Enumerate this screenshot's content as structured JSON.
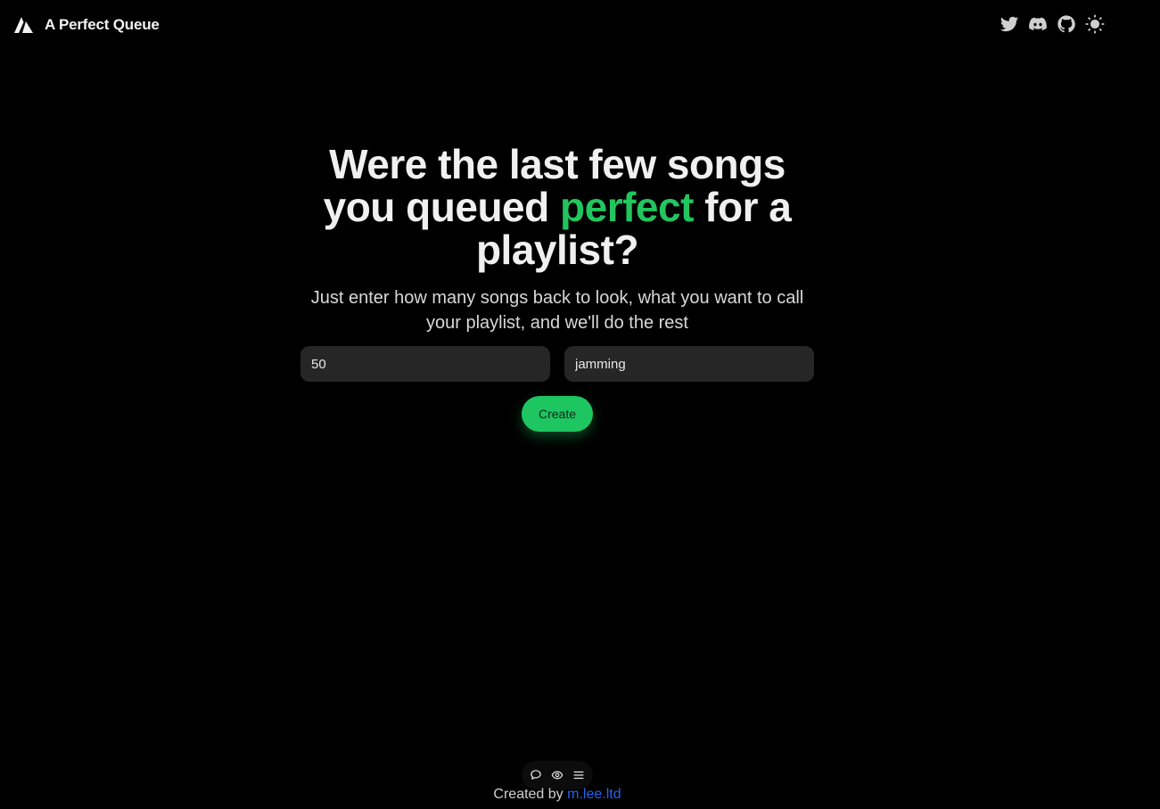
{
  "header": {
    "brand_name": "A Perfect Queue",
    "icons": [
      "twitter-icon",
      "discord-icon",
      "github-icon",
      "theme-toggle-icon"
    ]
  },
  "hero": {
    "title_part1": "Were the last few songs you queued ",
    "title_accent": "perfect",
    "title_part2": " for a playlist?",
    "subtitle": "Just enter how many songs back to look, what you want to call your playlist, and we'll do the rest"
  },
  "form": {
    "song_count_value": "50",
    "playlist_name_value": "jamming",
    "create_label": "Create"
  },
  "toolbar": {
    "icons": [
      "chat-bubble-icon",
      "eye-icon",
      "menu-icon"
    ]
  },
  "footer": {
    "prefix": "Created by",
    "link_text": "m.lee.ltd"
  },
  "colors": {
    "background": "#000000",
    "accent": "#22c55e",
    "button": "#1ec661",
    "input_bg": "#262626",
    "link": "#2563eb"
  }
}
